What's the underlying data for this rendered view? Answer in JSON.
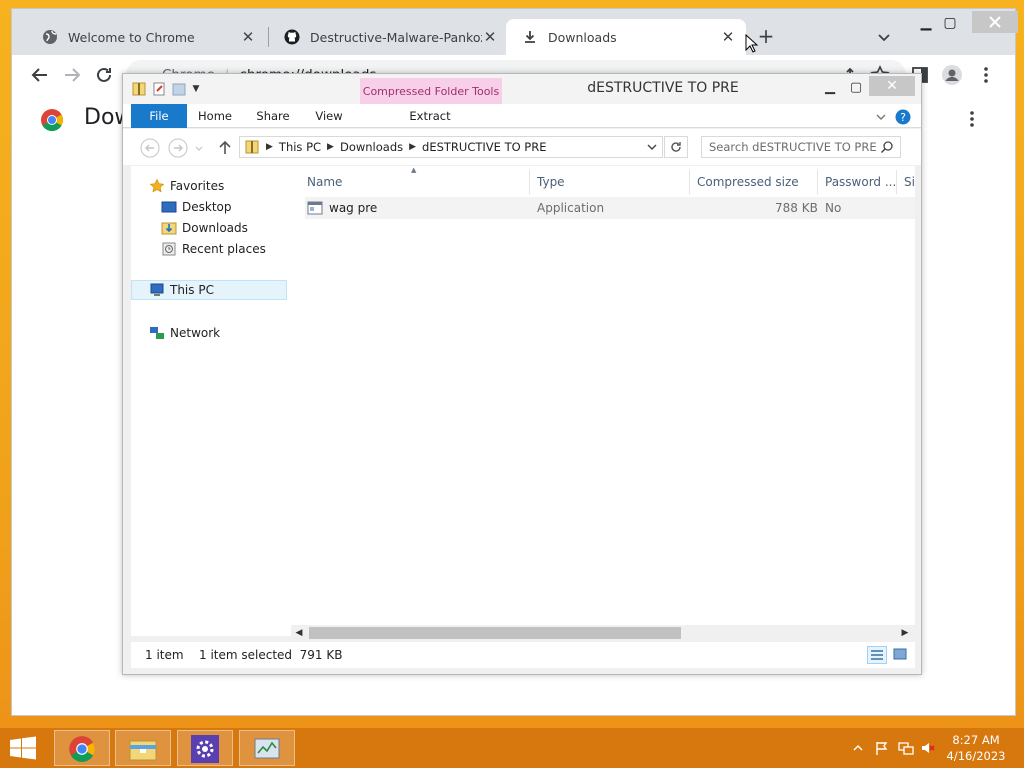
{
  "browser": {
    "tabs": [
      {
        "title": "Welcome to Chrome",
        "icon": "globe-icon",
        "active": false
      },
      {
        "title": "Destructive-Malware-Pankoza-pl",
        "icon": "github-icon",
        "active": false
      },
      {
        "title": "Downloads",
        "icon": "download-icon",
        "active": true
      }
    ],
    "new_tab_label": "+",
    "omnibox": {
      "chip": "Chrome",
      "url": "chrome://downloads"
    },
    "page_heading": "Downloads"
  },
  "explorer": {
    "title": "dESTRUCTIVE TO PRE",
    "context_tab": "Compressed Folder Tools",
    "ribbon_tabs": [
      "File",
      "Home",
      "Share",
      "View",
      "Extract"
    ],
    "breadcrumb": [
      "This PC",
      "Downloads",
      "dESTRUCTIVE TO PRE"
    ],
    "search_placeholder": "Search dESTRUCTIVE TO PRE",
    "nav": {
      "favorites_label": "Favorites",
      "favorites": [
        "Desktop",
        "Downloads",
        "Recent places"
      ],
      "this_pc": "This PC",
      "network": "Network"
    },
    "columns": [
      "Name",
      "Type",
      "Compressed size",
      "Password ...",
      "Si"
    ],
    "files": [
      {
        "name": "wag pre",
        "type": "Application",
        "compressed_size": "788 KB",
        "password": "No"
      }
    ],
    "status": {
      "count": "1 item",
      "selection": "1 item selected  791 KB"
    }
  },
  "taskbar": {
    "apps": [
      "chrome-icon",
      "file-explorer-icon",
      "settings-icon",
      "task-manager-icon"
    ],
    "clock": {
      "time": "8:27 AM",
      "date": "4/16/2023"
    }
  },
  "colors": {
    "desktop": "#f1a51c",
    "taskbar": "#d7780f",
    "ribbon_file": "#1979ca",
    "context_tab_bg": "#f7cfe8",
    "context_tab_text": "#a03070"
  }
}
